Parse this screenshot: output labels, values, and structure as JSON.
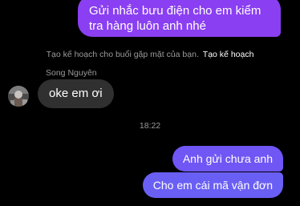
{
  "messages": {
    "outgoing_top": "Gửi nhắc bưu điện cho em kiểm tra hàng luôn anh nhé",
    "plan_hint": "Tạo kế hoạch cho buổi gặp mặt của bạn.",
    "plan_link": "Tạo kế hoạch",
    "sender_name": "Song Nguyên",
    "incoming": "oke em ơi",
    "timestamp": "18:22",
    "outgoing_1": "Anh gửi chưa anh",
    "outgoing_2": "Cho em cái mã vận đơn"
  },
  "colors": {
    "background": "#000000",
    "outgoing_bubble": "#8a3ff2",
    "incoming_bubble": "#303030",
    "muted_text": "#9a9a9a"
  },
  "icons": {
    "avatar": "contact-avatar"
  }
}
